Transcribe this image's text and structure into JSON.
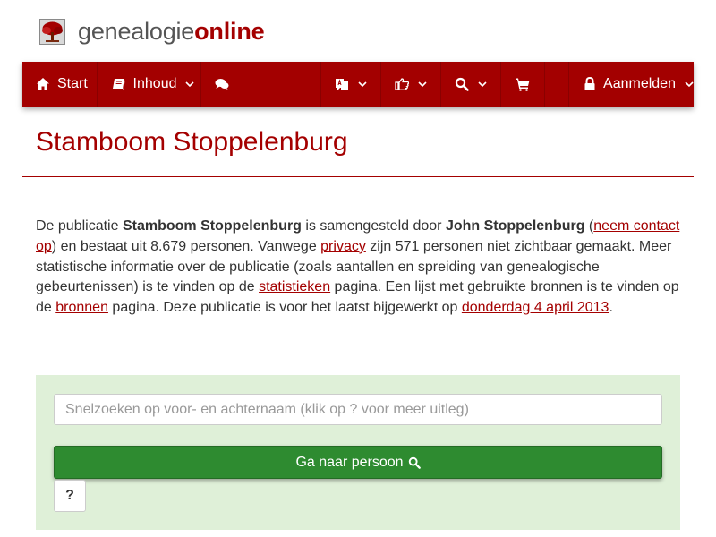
{
  "logo": {
    "text_plain": "genealogie",
    "text_bold": "online"
  },
  "nav": {
    "start_label": "Start",
    "content_label": "Inhoud",
    "login_label": "Aanmelden",
    "icons": [
      "home-icon",
      "book-icon",
      "comments-icon",
      "language-icon",
      "hand-point-icon",
      "search-icon",
      "cart-icon",
      "lock-icon"
    ]
  },
  "page": {
    "title": "Stamboom Stoppelenburg"
  },
  "description": {
    "t1": "De publicatie ",
    "pub_name": "Stamboom Stoppelenburg",
    "t2": " is samengesteld door ",
    "author": "John Stoppelenburg",
    "t3": " (",
    "contact_link": "neem contact op",
    "t4": ") en bestaat uit 8.679 personen. Vanwege ",
    "privacy_link": "privacy",
    "t5": " zijn 571 personen niet zichtbaar gemaakt. Meer statistische informatie over de publicatie (zoals aantallen en spreiding van genealogische gebeurtenissen) is te vinden op de ",
    "stats_link": "statistieken",
    "t6": " pagina. Een lijst met gebruikte bronnen is te vinden op de ",
    "sources_link": "bronnen",
    "t7": " pagina. Deze publicatie is voor het laatst bijgewerkt op ",
    "date_link": "donderdag 4 april 2013",
    "t8": "."
  },
  "search": {
    "placeholder": "Snelzoeken op voor- en achternaam (klik op ? voor meer uitleg)",
    "go_label": "Ga naar persoon",
    "help_label": "?"
  },
  "colors": {
    "brand": "#a30000",
    "go_button": "#2e8b30",
    "panel": "#dff0d8"
  }
}
